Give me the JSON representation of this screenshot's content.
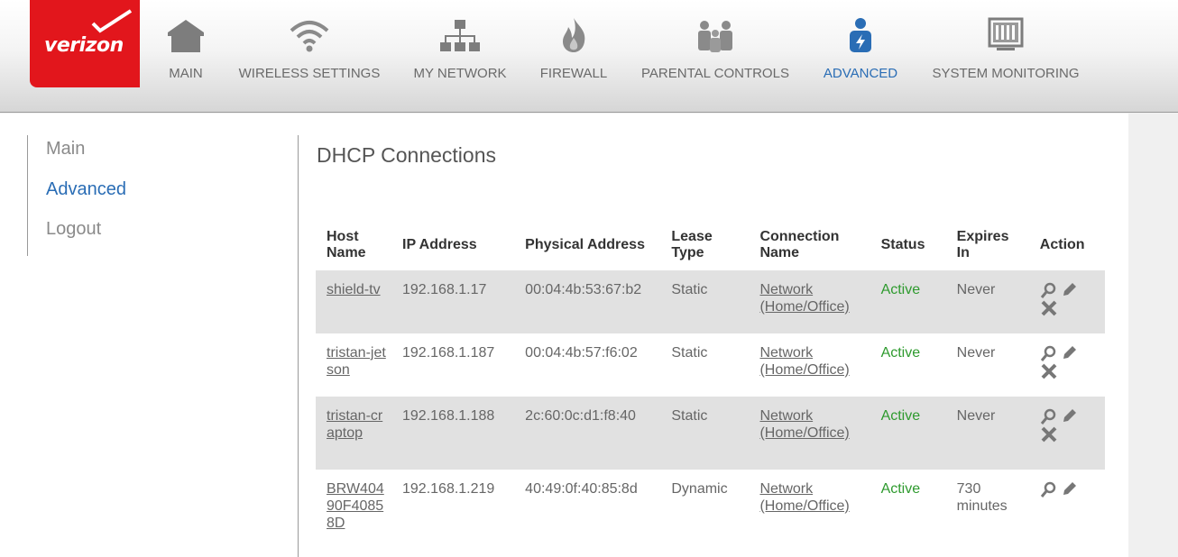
{
  "brand": {
    "name": "verizon",
    "accent": "#e2161c"
  },
  "nav": [
    {
      "label": "MAIN",
      "icon": "house-icon",
      "active": false
    },
    {
      "label": "WIRELESS SETTINGS",
      "icon": "wifi-icon",
      "active": false
    },
    {
      "label": "MY NETWORK",
      "icon": "network-icon",
      "active": false
    },
    {
      "label": "FIREWALL",
      "icon": "flame-icon",
      "active": false
    },
    {
      "label": "PARENTAL CONTROLS",
      "icon": "family-icon",
      "active": false
    },
    {
      "label": "ADVANCED",
      "icon": "advanced-user-icon",
      "active": true
    },
    {
      "label": "SYSTEM MONITORING",
      "icon": "monitor-icon",
      "active": false
    }
  ],
  "sidebar": [
    {
      "label": "Main",
      "active": false
    },
    {
      "label": "Advanced",
      "active": true
    },
    {
      "label": "Logout",
      "active": false
    }
  ],
  "page": {
    "title": "DHCP Connections"
  },
  "table": {
    "headers": [
      "Host Name",
      "IP Address",
      "Physical Address",
      "Lease Type",
      "Connection Name",
      "Status",
      "Expires In",
      "Action"
    ],
    "rows": [
      {
        "host": "shield-tv",
        "ip": "192.168.1.17",
        "mac": "00:04:4b:53:67:b2",
        "lease": "Static",
        "connection": "Network (Home/Office)",
        "status": "Active",
        "expires": "Never",
        "actions": [
          "view-icon",
          "edit-icon",
          "delete-icon"
        ]
      },
      {
        "host": "tristan-jetson",
        "ip": "192.168.1.187",
        "mac": "00:04:4b:57:f6:02",
        "lease": "Static",
        "connection": "Network (Home/Office)",
        "status": "Active",
        "expires": "Never",
        "actions": [
          "view-icon",
          "edit-icon",
          "delete-icon"
        ]
      },
      {
        "host": "tristan-craptop",
        "ip": "192.168.1.188",
        "mac": "2c:60:0c:d1:f8:40",
        "lease": "Static",
        "connection": "Network (Home/Office)",
        "status": "Active",
        "expires": "Never",
        "actions": [
          "view-icon",
          "edit-icon",
          "delete-icon"
        ]
      },
      {
        "host": "BRW40490F40858D",
        "ip": "192.168.1.219",
        "mac": "40:49:0f:40:85:8d",
        "lease": "Dynamic",
        "connection": "Network (Home/Office)",
        "status": "Active",
        "expires": "730 minutes",
        "actions": [
          "view-icon",
          "edit-icon"
        ]
      }
    ]
  }
}
